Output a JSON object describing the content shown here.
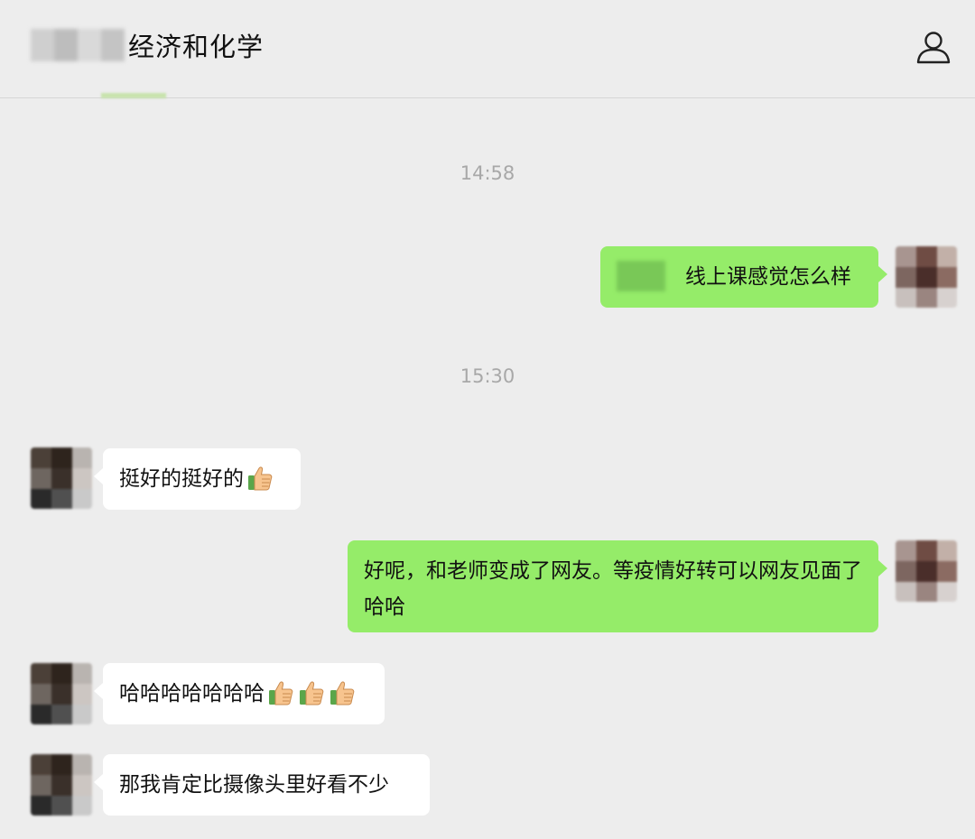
{
  "header": {
    "title": "经济和化学"
  },
  "messages": [
    {
      "time": "14:58"
    },
    {
      "side": "right",
      "text": "线上课感觉怎么样"
    },
    {
      "time": "15:30"
    },
    {
      "side": "left",
      "text": "挺好的挺好的"
    },
    {
      "side": "right",
      "text": "好呢，和老师变成了网友。等疫情好转可以网友见面了哈哈"
    },
    {
      "side": "left",
      "text": "哈哈哈哈哈哈哈"
    },
    {
      "side": "left",
      "text": "那我肯定比摄像头里好看不少"
    }
  ],
  "colors": {
    "background": "#ededed",
    "sent_bubble": "#95ec69",
    "received_bubble": "#ffffff",
    "timestamp": "#a8a8a8"
  },
  "icons": {
    "profile": "person-icon",
    "emoji": "thumbs-up-icon"
  }
}
